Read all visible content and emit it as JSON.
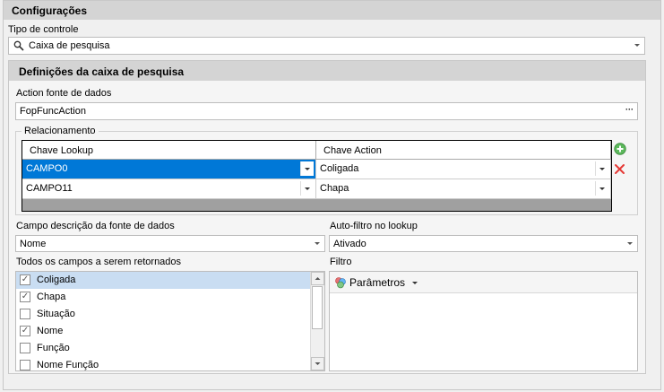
{
  "config": {
    "title": "Configurações"
  },
  "control_type": {
    "label": "Tipo de controle",
    "value": "Caixa de pesquisa",
    "icon": "search-icon"
  },
  "search_box": {
    "title": "Definições da caixa de pesquisa",
    "datasource": {
      "label": "Action fonte de dados",
      "value": "FopFuncAction",
      "button": "···"
    },
    "relationship": {
      "group_label": "Relacionamento",
      "columns": [
        "Chave Lookup",
        "Chave Action"
      ],
      "rows": [
        {
          "lookup": "CAMPO0",
          "action": "Coligada",
          "selected": true
        },
        {
          "lookup": "CAMPO11",
          "action": "Chapa",
          "selected": false
        }
      ],
      "add_icon": "plus-circle-icon",
      "remove_icon": "x-icon"
    },
    "description_field": {
      "label": "Campo descrição da fonte de dados",
      "value": "Nome"
    },
    "autofilter": {
      "label": "Auto-filtro no lookup",
      "value": "Ativado"
    },
    "return_fields": {
      "label": "Todos os campos a serem retornados",
      "items": [
        {
          "label": "Coligada",
          "checked": true,
          "selected": true
        },
        {
          "label": "Chapa",
          "checked": true,
          "selected": false
        },
        {
          "label": "Situação",
          "checked": false,
          "selected": false
        },
        {
          "label": "Nome",
          "checked": true,
          "selected": false
        },
        {
          "label": "Função",
          "checked": false,
          "selected": false
        },
        {
          "label": "Nome Função",
          "checked": false,
          "selected": false
        }
      ]
    },
    "filter": {
      "label": "Filtro",
      "button": "Parâmetros"
    }
  }
}
